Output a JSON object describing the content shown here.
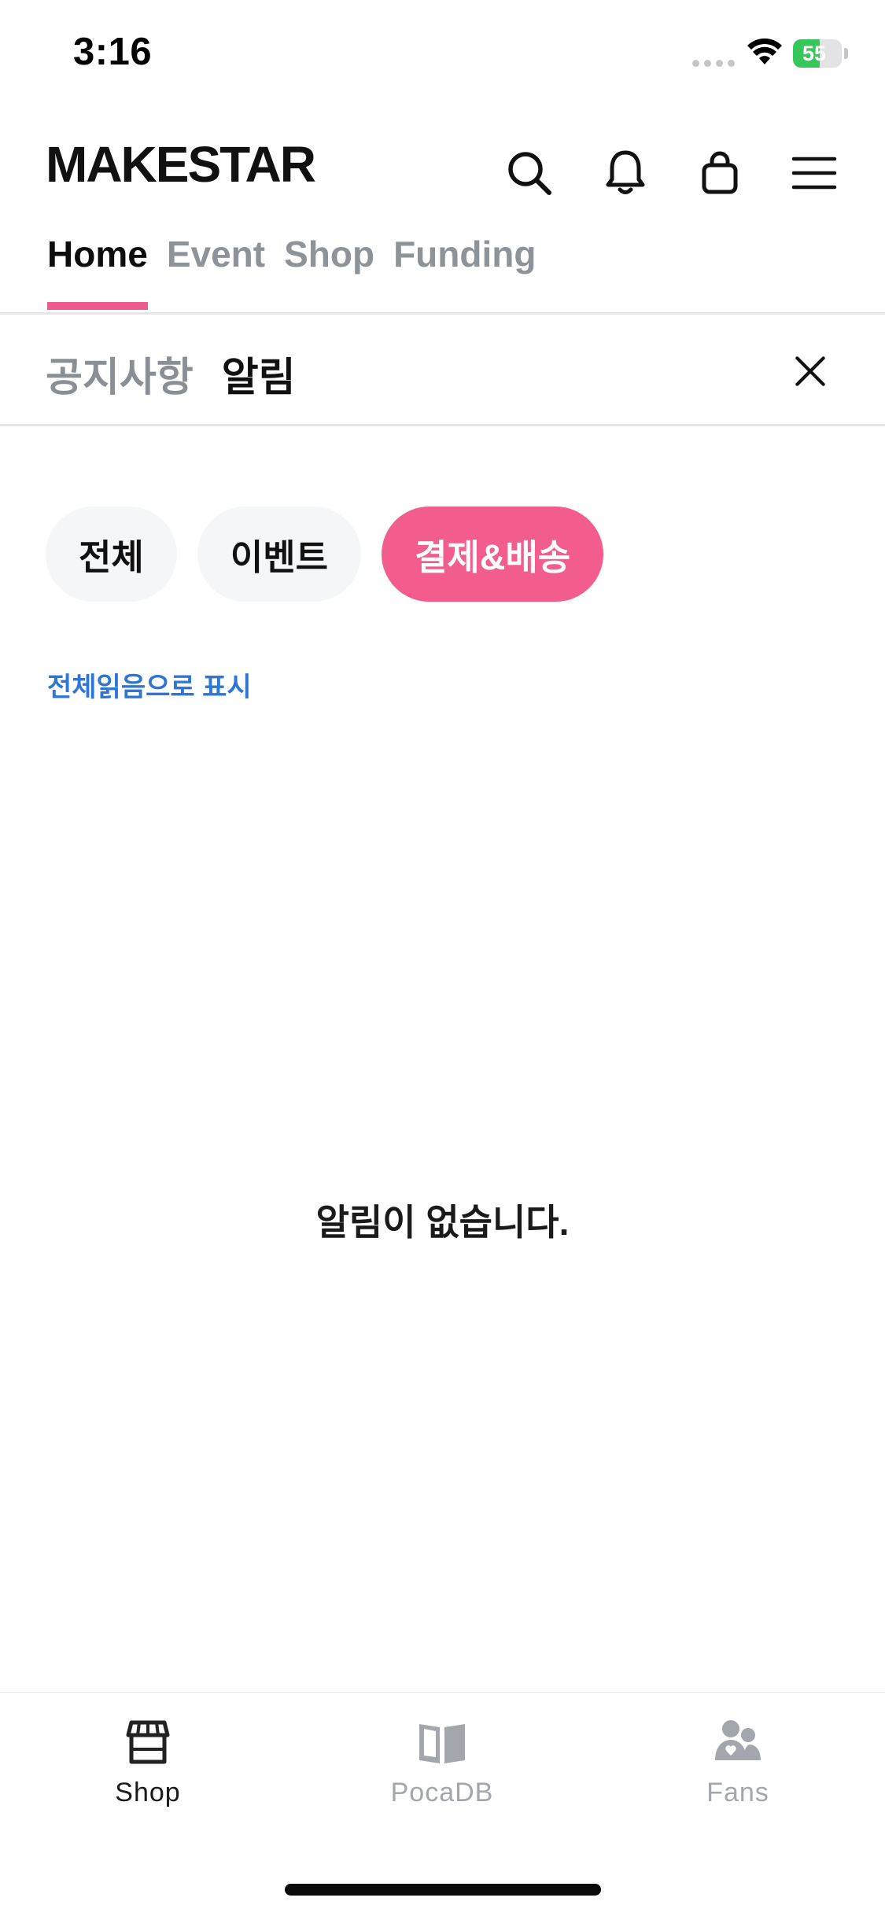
{
  "status_bar": {
    "time": "3:16",
    "battery_level": "55",
    "battery_percent": 55
  },
  "header": {
    "logo": "MAKESTAR",
    "icons": [
      "search-icon",
      "bell-icon",
      "shopping-bag-icon",
      "menu-icon"
    ]
  },
  "main_tabs": {
    "items": [
      {
        "label": "Home",
        "active": true
      },
      {
        "label": "Event",
        "active": false
      },
      {
        "label": "Shop",
        "active": false
      },
      {
        "label": "Funding",
        "active": false
      }
    ]
  },
  "sub_tabs": {
    "notice_label": "공지사항",
    "alarm_label": "알림"
  },
  "filters": {
    "all_label": "전체",
    "event_label": "이벤트",
    "payment_label": "결제&배송",
    "selected": "결제&배송"
  },
  "mark_all_read_label": "전체읽음으로 표시",
  "empty_message": "알림이 없습니다.",
  "bottom_nav": {
    "shop_label": "Shop",
    "pocadb_label": "PocaDB",
    "fans_label": "Fans"
  },
  "colors": {
    "accent": "#f25d8e",
    "link": "#2f76d4",
    "battery": "#35c759"
  }
}
